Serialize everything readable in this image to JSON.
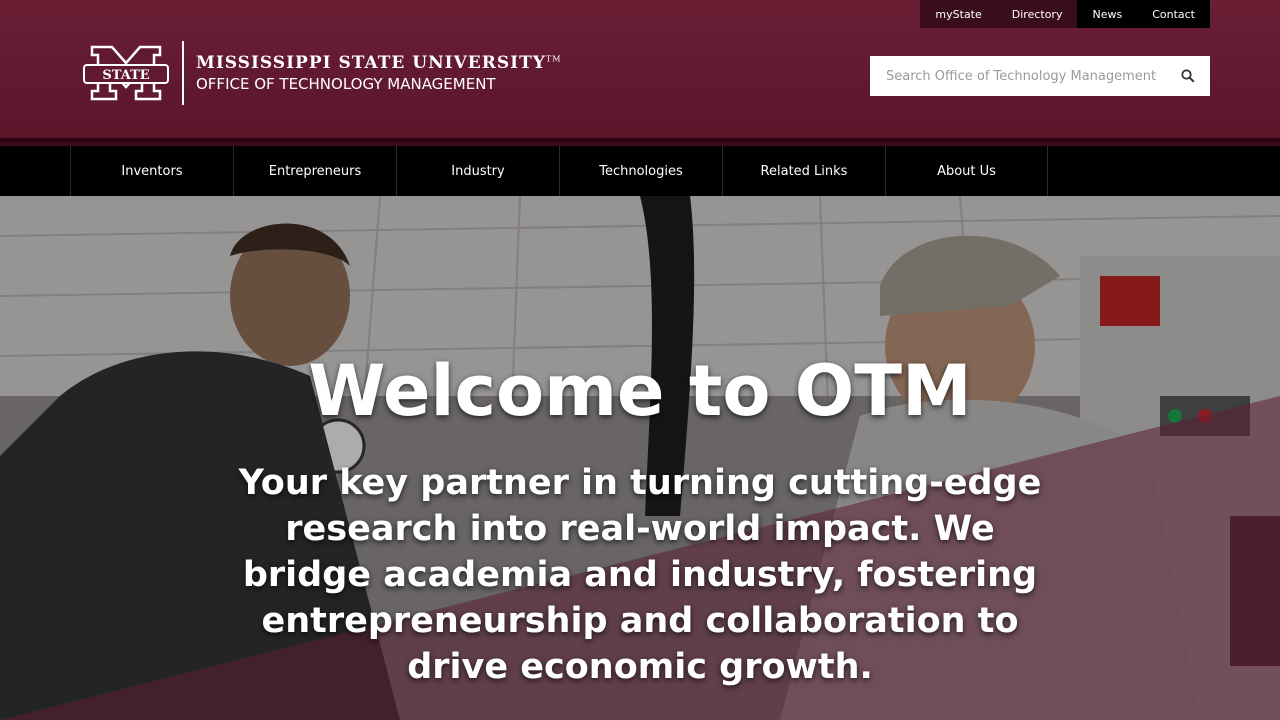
{
  "utility_nav": {
    "items": [
      {
        "label": "myState"
      },
      {
        "label": "Directory"
      },
      {
        "label": "News"
      },
      {
        "label": "Contact"
      }
    ]
  },
  "logo": {
    "line1": "MISSISSIPPI STATE UNIVERSITY",
    "trademark": "TM",
    "line2": "OFFICE OF TECHNOLOGY MANAGEMENT",
    "badge_text": "STATE"
  },
  "search": {
    "placeholder": "Search Office of Technology Management",
    "icon": "search-icon"
  },
  "main_nav": {
    "items": [
      {
        "label": "Inventors"
      },
      {
        "label": "Entrepreneurs"
      },
      {
        "label": "Industry"
      },
      {
        "label": "Technologies"
      },
      {
        "label": "Related Links"
      },
      {
        "label": "About Us"
      }
    ]
  },
  "hero": {
    "title": "Welcome to OTM",
    "subtitle": "Your key partner in turning cutting-edge research into real-world impact. We bridge academia and industry, fostering entrepreneurship and collaboration to drive economic growth."
  },
  "colors": {
    "maroon": "#61192f",
    "nav_bg": "#000000",
    "overlay_maroon": "#7a2a44"
  }
}
